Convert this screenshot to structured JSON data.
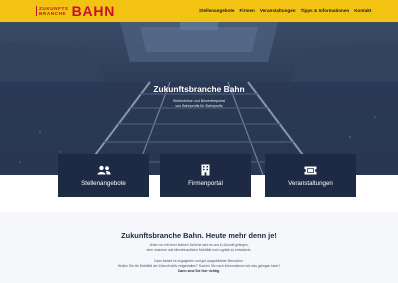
{
  "header": {
    "logo_small_top": "ZUKUNFTS",
    "logo_small_bottom": "BRANCHE",
    "logo_big": "BAHN",
    "nav": [
      "Stellenangebote",
      "Firmen",
      "Veranstaltungen",
      "Tipps & Informationen",
      "Kontakt"
    ]
  },
  "hero": {
    "title": "Zukunftsbranche Bahn",
    "subtitle_line1": "Stellenbörse und Bewerberportal",
    "subtitle_line2": "von Bahnprofis für Bahnprofis"
  },
  "cards": [
    {
      "label": "Stellenangebote",
      "icon": "users-icon"
    },
    {
      "label": "Firmenportal",
      "icon": "building-icon"
    },
    {
      "label": "Veranstaltungen",
      "icon": "ticket-icon"
    }
  ],
  "lower": {
    "title": "Zukunftsbranche Bahn. Heute mehr denn je!",
    "line1": "Jeder nur mit einer starken Schiene wird es uns in Zukunft gelingen,",
    "line2": "eine moderne und klimafreundliche Mobilität und Logistik zu entwickeln.",
    "line3": "Dazu bedarf es engagierter und gut ausgebildeter Menschen.",
    "line4": "Wollen Sie die Mobilität der Zukunft aktiv mitgestalten? Suchen Sie nach Informationen wie das gelingen kann?",
    "bold": "Dann sind Sie hier richtig."
  },
  "colors": {
    "header_bg": "#f2c313",
    "logo_red": "#c8102e",
    "card_bg": "#1e2a44"
  }
}
